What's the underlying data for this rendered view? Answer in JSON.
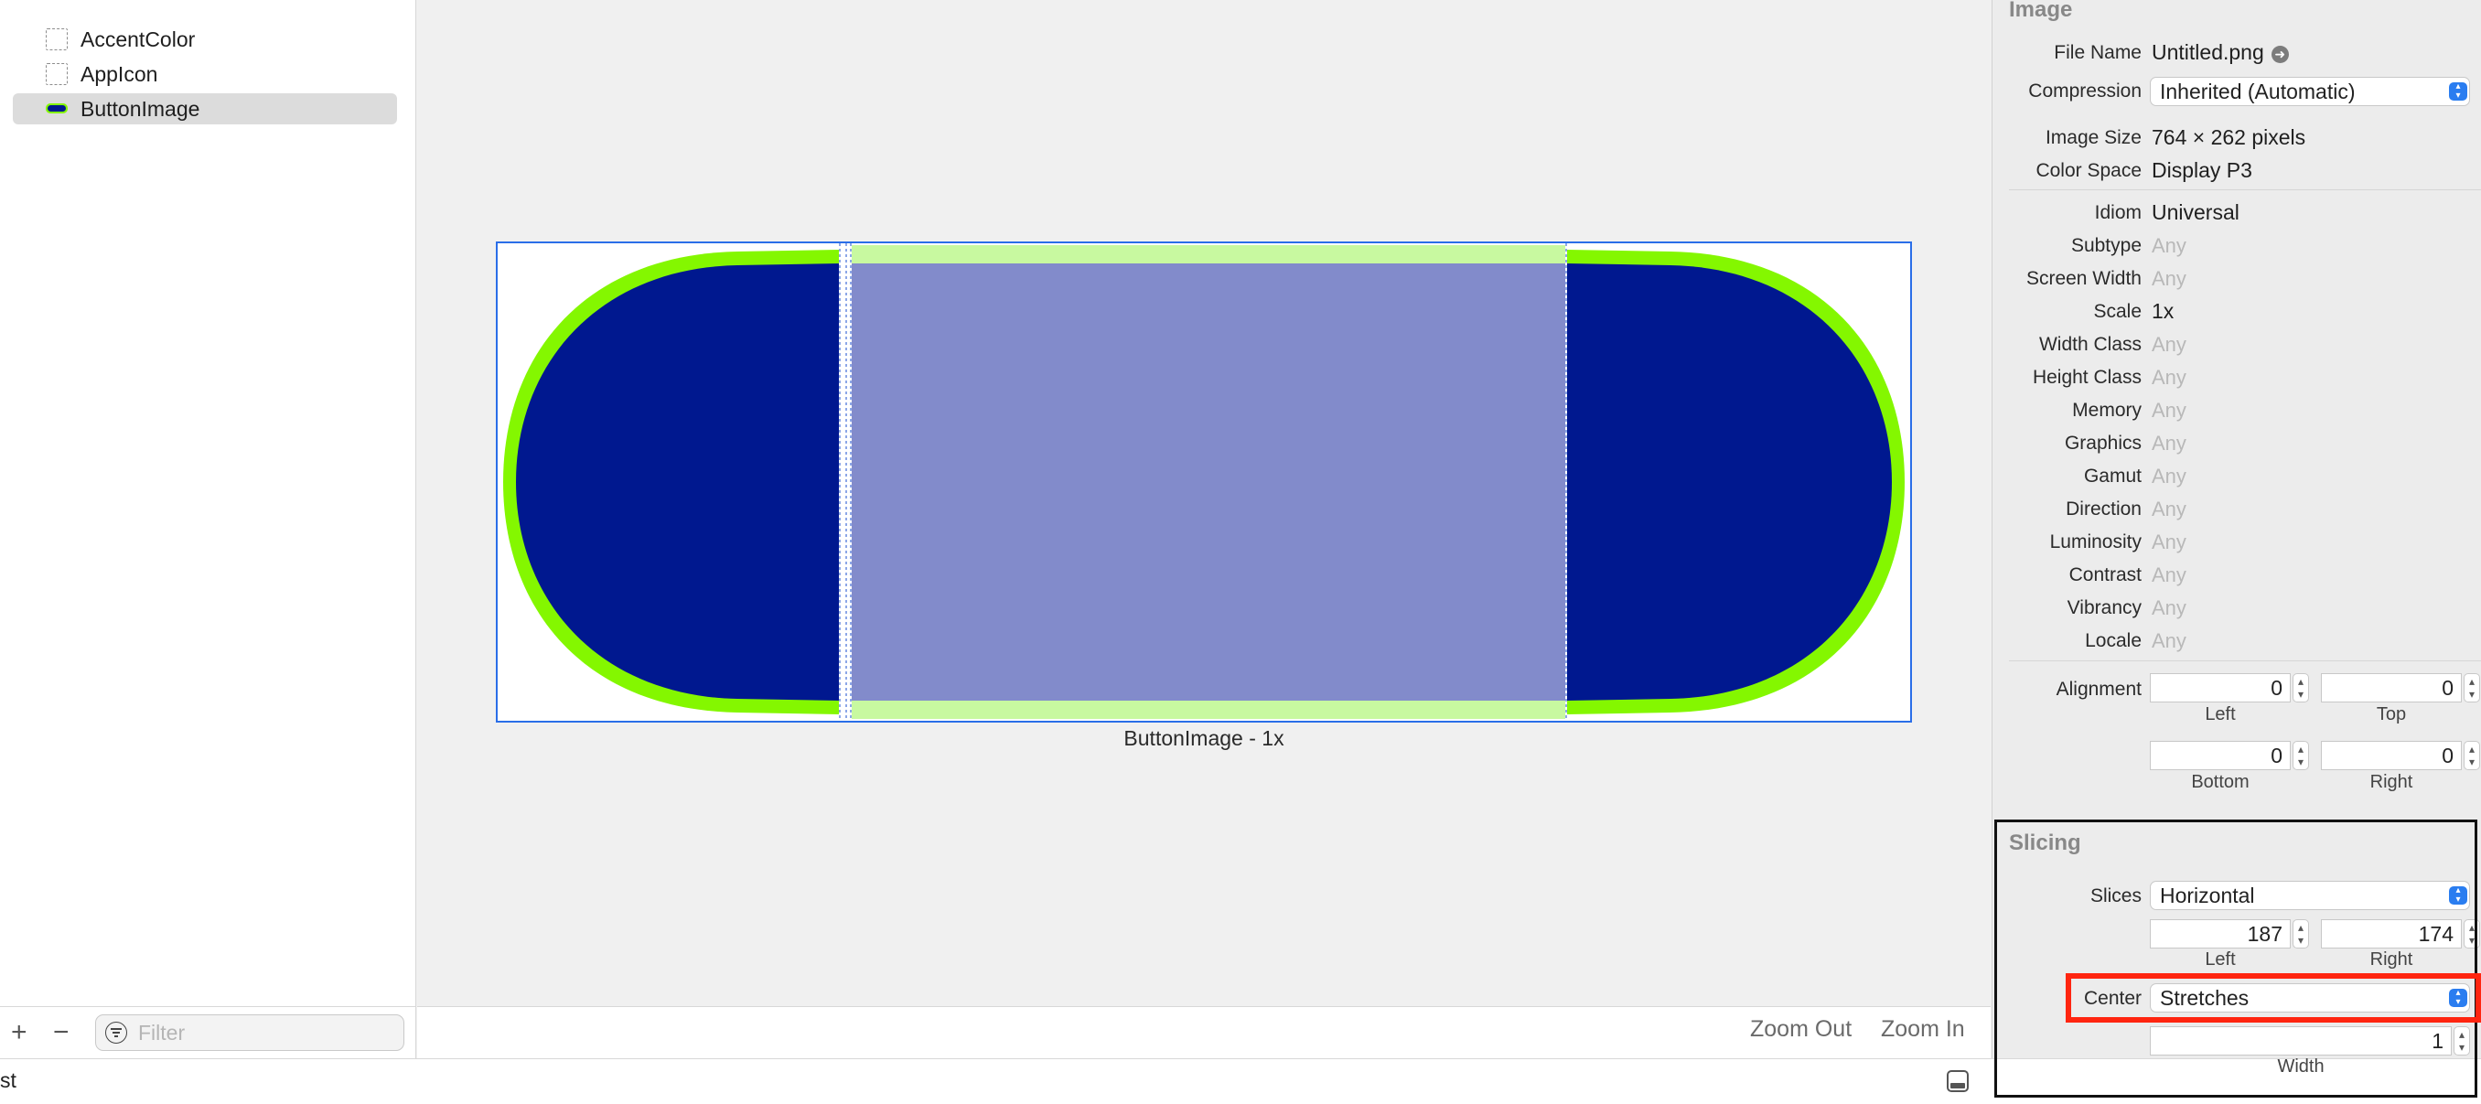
{
  "navigator": {
    "assets": [
      {
        "label": "AccentColor",
        "icon": "color-set-icon",
        "selected": false
      },
      {
        "label": "AppIcon",
        "icon": "app-icon-set-icon",
        "selected": false
      },
      {
        "label": "ButtonImage",
        "icon": "image-set-thumbnail",
        "selected": true
      }
    ],
    "add_symbol": "+",
    "remove_symbol": "−",
    "filter_placeholder": "Filter"
  },
  "canvas": {
    "caption": "ButtonImage - 1x",
    "colors": {
      "border_green": "#84f700",
      "fill_blue": "#00188f",
      "center_tint": "#828bcb",
      "center_green": "#c8f9a0",
      "selection": "#2a6ee8"
    }
  },
  "editor_footer": {
    "zoom_out": "Zoom Out",
    "zoom_in": "Zoom In"
  },
  "status_bar": {
    "text": "st"
  },
  "inspector": {
    "image_section": {
      "title": "Image",
      "file_name_label": "File Name",
      "file_name_value": "Untitled.png",
      "compression_label": "Compression",
      "compression_value": "Inherited (Automatic)",
      "image_size_label": "Image Size",
      "image_size_value": "764 × 262 pixels",
      "color_space_label": "Color Space",
      "color_space_value": "Display P3",
      "idiom_label": "Idiom",
      "idiom_value": "Universal",
      "traits": [
        {
          "label": "Subtype",
          "value": "Any"
        },
        {
          "label": "Screen Width",
          "value": "Any"
        },
        {
          "label": "Scale",
          "value": "1x"
        },
        {
          "label": "Width Class",
          "value": "Any"
        },
        {
          "label": "Height Class",
          "value": "Any"
        },
        {
          "label": "Memory",
          "value": "Any"
        },
        {
          "label": "Graphics",
          "value": "Any"
        },
        {
          "label": "Gamut",
          "value": "Any"
        },
        {
          "label": "Direction",
          "value": "Any"
        },
        {
          "label": "Luminosity",
          "value": "Any"
        },
        {
          "label": "Contrast",
          "value": "Any"
        },
        {
          "label": "Vibrancy",
          "value": "Any"
        },
        {
          "label": "Locale",
          "value": "Any"
        }
      ],
      "alignment_label": "Alignment",
      "alignment": {
        "left": {
          "value": "0",
          "caption": "Left"
        },
        "top": {
          "value": "0",
          "caption": "Top"
        },
        "bottom": {
          "value": "0",
          "caption": "Bottom"
        },
        "right": {
          "value": "0",
          "caption": "Right"
        }
      }
    },
    "slicing_section": {
      "title": "Slicing",
      "slices_label": "Slices",
      "slices_value": "Horizontal",
      "left": {
        "value": "187",
        "caption": "Left"
      },
      "right": {
        "value": "174",
        "caption": "Right"
      },
      "center_label": "Center",
      "center_value": "Stretches",
      "width": {
        "value": "1",
        "caption": "Width"
      }
    },
    "accent_color": "#2a7df0",
    "highlight_color": "#ff2510"
  }
}
